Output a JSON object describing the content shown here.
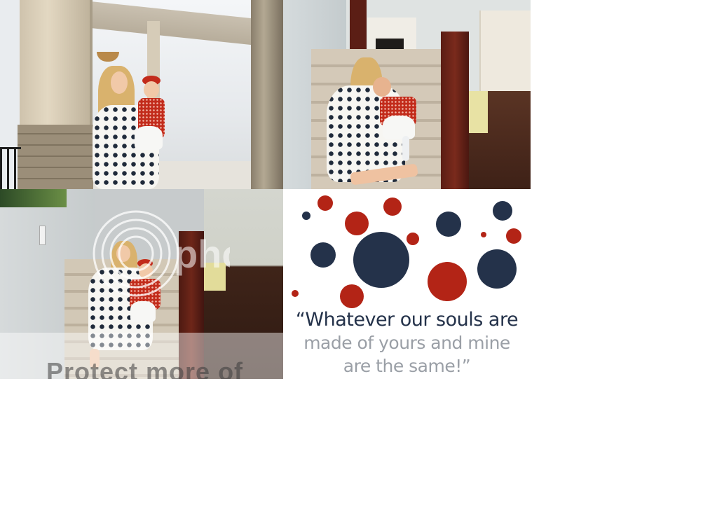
{
  "photos": [
    {
      "id": "porch",
      "description": "porch"
    },
    {
      "id": "stairs-kiss",
      "description": "stairs"
    },
    {
      "id": "stairs-watermarked",
      "description": "stairs"
    }
  ],
  "watermark": {
    "text": "Protect more of",
    "logo_word": "photo"
  },
  "quote": {
    "line1": "“Whatever our souls are",
    "line2": "made of yours and mine",
    "line3": "are the same!”"
  },
  "colors": {
    "navy": "#24324a",
    "red": "#b32416",
    "grey": "#9a9fa6"
  },
  "icons": {
    "watermark_logo": "photobucket-watermark-icon"
  }
}
